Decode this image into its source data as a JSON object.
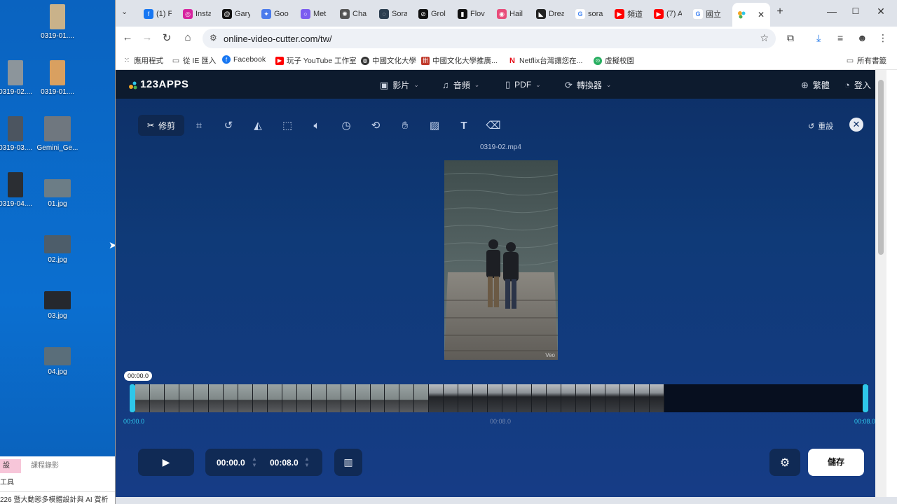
{
  "desktop": {
    "icons": [
      {
        "label": "0319-01....",
        "tone": "#c9b28a"
      },
      {
        "label": "0319-02....",
        "tone": "#8c959b"
      },
      {
        "label": "0319-01....",
        "tone": "#d9a060"
      },
      {
        "label": "0319-03....",
        "tone": "#4c5560"
      },
      {
        "label": "Gemini_Ge...",
        "tone": "#6f777f"
      },
      {
        "label": "0319-04....",
        "tone": "#2b2e33"
      },
      {
        "label": "01.jpg",
        "tone": "#6c7d86"
      },
      {
        "label": "02.jpg",
        "tone": "#4d5d6a"
      },
      {
        "label": "03.jpg",
        "tone": "#25282e"
      },
      {
        "label": "04.jpg",
        "tone": "#5a6e7a"
      }
    ],
    "panel": {
      "tab_active": "設",
      "tab_other": "課程錄影",
      "tool": "工具",
      "footer": "226 暨大動態多模體設計與 AI 賞析"
    }
  },
  "browser": {
    "tabs": [
      {
        "label": "(1) F",
        "icon": "facebook-icon",
        "color": "#1877f2",
        "glyph": "f"
      },
      {
        "label": "Insta",
        "icon": "instagram-icon",
        "color": "#d6249f",
        "glyph": "◎"
      },
      {
        "label": "Gary",
        "icon": "threads-icon",
        "color": "#111111",
        "glyph": "@"
      },
      {
        "label": "Goo",
        "icon": "gemini-icon",
        "color": "#4b7bec",
        "glyph": "✦"
      },
      {
        "label": "Met",
        "icon": "meta-ai-icon",
        "color": "#7b5cf0",
        "glyph": "○"
      },
      {
        "label": "Cha",
        "icon": "chatgpt-icon",
        "color": "#555555",
        "glyph": "✺"
      },
      {
        "label": "Sora",
        "icon": "sora-icon",
        "color": "#2c3e50",
        "glyph": "◌"
      },
      {
        "label": "Grol",
        "icon": "grok-icon",
        "color": "#111111",
        "glyph": "⊘"
      },
      {
        "label": "Flov",
        "icon": "flow-icon",
        "color": "#111111",
        "glyph": "▮"
      },
      {
        "label": "Hail",
        "icon": "hailuo-icon",
        "color": "#e84c7a",
        "glyph": "◉"
      },
      {
        "label": "Drea",
        "icon": "dreamina-icon",
        "color": "#222222",
        "glyph": "◣"
      },
      {
        "label": "sora",
        "icon": "google-icon",
        "color": "#ffffff",
        "glyph": "G"
      },
      {
        "label": "頻道",
        "icon": "youtube-icon",
        "color": "#ff0000",
        "glyph": "▶"
      },
      {
        "label": "(7) A",
        "icon": "youtube-icon",
        "color": "#ff0000",
        "glyph": "▶"
      },
      {
        "label": "國立",
        "icon": "google-icon",
        "color": "#ffffff",
        "glyph": "G"
      }
    ],
    "url": "online-video-cutter.com/tw/",
    "bookmarks": [
      {
        "label": "應用程式",
        "icon": "apps-grid-icon"
      },
      {
        "label": "從 IE 匯入",
        "icon": "folder-icon"
      },
      {
        "label": "Facebook",
        "icon": "facebook-icon"
      },
      {
        "label": "玩子 YouTube 工作室",
        "icon": "youtube-icon"
      },
      {
        "label": "中國文化大學",
        "icon": "globe-icon"
      },
      {
        "label": "中國文化大學推廣...",
        "icon": "pccu-icon"
      },
      {
        "label": "Netflix台灣讓您在...",
        "icon": "netflix-icon"
      },
      {
        "label": "虛擬校園",
        "icon": "campus-icon"
      }
    ],
    "all_bookmarks": "所有書籤"
  },
  "app": {
    "logo": "123APPS",
    "nav": [
      {
        "label": "影片",
        "icon": "video-icon"
      },
      {
        "label": "音頻",
        "icon": "music-note-icon"
      },
      {
        "label": "PDF",
        "icon": "document-icon"
      },
      {
        "label": "轉換器",
        "icon": "convert-icon"
      }
    ],
    "language": "繁體",
    "login": "登入",
    "tools": {
      "active_label": "修剪",
      "items": [
        "crop-icon",
        "rotate-icon",
        "flip-icon",
        "resize-icon",
        "volume-icon",
        "speed-icon",
        "loop-icon",
        "stabilize-icon",
        "image-icon",
        "text-icon",
        "watermark-remove-icon"
      ]
    },
    "reset": "重設",
    "filename": "0319-02.mp4",
    "watermark": "Veo",
    "timeline": {
      "playhead": "00:00.0",
      "start": "00:00.0",
      "mid": "00:08.0",
      "end": "00:08.0"
    },
    "controls": {
      "start_time": "00:00.0",
      "end_time": "00:08.0",
      "save": "儲存"
    }
  }
}
